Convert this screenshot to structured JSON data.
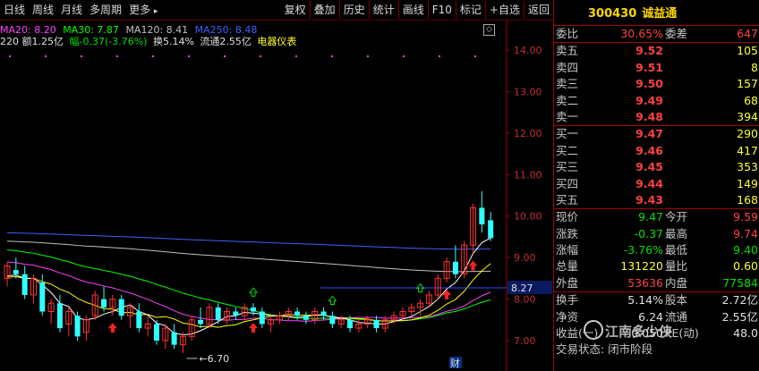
{
  "toolbar": {
    "left": [
      "日线",
      "周线",
      "月线",
      "多周期",
      "更多"
    ],
    "more_arrow": "▸",
    "right": [
      "复权",
      "叠加",
      "历史",
      "统计",
      "画线",
      "F10",
      "标记",
      "+自选",
      "返回"
    ]
  },
  "ma_line": {
    "ma20": "MA20: 8.20",
    "ma30": "MA30: 7.87",
    "ma120": "MA120: 8.41",
    "ma250": "MA250: 8.48"
  },
  "info_line": {
    "vol": "220 额1.25亿",
    "chg": "幅-0.37(-3.76%)",
    "turn": "换5.14%",
    "float": "流通2.55亿",
    "sector": "电器仪表"
  },
  "close_glyph": "◇",
  "chart_data": {
    "type": "candlestick",
    "y_ticks": [
      "14.00",
      "13.00",
      "12.00",
      "11.00",
      "10.00",
      "9.00",
      "8.00",
      "7.00"
    ],
    "ylim": [
      6.7,
      14.6
    ],
    "price_tag": "8.27",
    "low_label": "6.70",
    "event_marker": "财",
    "candles": [
      {
        "o": 8.5,
        "h": 8.9,
        "l": 8.3,
        "c": 8.8
      },
      {
        "o": 8.7,
        "h": 9.0,
        "l": 8.5,
        "c": 8.6
      },
      {
        "o": 8.6,
        "h": 8.8,
        "l": 8.0,
        "c": 8.1
      },
      {
        "o": 8.1,
        "h": 8.6,
        "l": 7.9,
        "c": 8.5
      },
      {
        "o": 8.4,
        "h": 8.6,
        "l": 7.6,
        "c": 7.7
      },
      {
        "o": 7.7,
        "h": 8.0,
        "l": 7.4,
        "c": 7.9
      },
      {
        "o": 7.9,
        "h": 8.1,
        "l": 7.2,
        "c": 7.3
      },
      {
        "o": 7.4,
        "h": 7.8,
        "l": 7.1,
        "c": 7.7
      },
      {
        "o": 7.6,
        "h": 7.7,
        "l": 7.0,
        "c": 7.1
      },
      {
        "o": 7.2,
        "h": 7.6,
        "l": 7.0,
        "c": 7.5
      },
      {
        "o": 7.6,
        "h": 8.2,
        "l": 7.5,
        "c": 8.1
      },
      {
        "o": 8.0,
        "h": 8.3,
        "l": 7.7,
        "c": 7.8
      },
      {
        "o": 7.8,
        "h": 8.1,
        "l": 7.6,
        "c": 8.0
      },
      {
        "o": 8.0,
        "h": 8.1,
        "l": 7.5,
        "c": 7.6
      },
      {
        "o": 7.6,
        "h": 7.9,
        "l": 7.3,
        "c": 7.8
      },
      {
        "o": 7.7,
        "h": 7.9,
        "l": 7.2,
        "c": 7.3
      },
      {
        "o": 7.3,
        "h": 7.6,
        "l": 7.1,
        "c": 7.4
      },
      {
        "o": 7.4,
        "h": 7.5,
        "l": 6.9,
        "c": 7.0
      },
      {
        "o": 7.0,
        "h": 7.4,
        "l": 6.8,
        "c": 7.3
      },
      {
        "o": 7.2,
        "h": 7.4,
        "l": 6.8,
        "c": 6.9
      },
      {
        "o": 6.9,
        "h": 7.2,
        "l": 6.7,
        "c": 7.1
      },
      {
        "o": 7.1,
        "h": 7.6,
        "l": 7.0,
        "c": 7.5
      },
      {
        "o": 7.5,
        "h": 7.8,
        "l": 7.3,
        "c": 7.4
      },
      {
        "o": 7.4,
        "h": 7.9,
        "l": 7.3,
        "c": 7.8
      },
      {
        "o": 7.8,
        "h": 7.9,
        "l": 7.4,
        "c": 7.5
      },
      {
        "o": 7.5,
        "h": 7.8,
        "l": 7.4,
        "c": 7.7
      },
      {
        "o": 7.7,
        "h": 7.8,
        "l": 7.5,
        "c": 7.6
      },
      {
        "o": 7.6,
        "h": 7.9,
        "l": 7.5,
        "c": 7.8
      },
      {
        "o": 7.8,
        "h": 7.9,
        "l": 7.6,
        "c": 7.7
      },
      {
        "o": 7.7,
        "h": 7.8,
        "l": 7.3,
        "c": 7.4
      },
      {
        "o": 7.4,
        "h": 7.6,
        "l": 7.2,
        "c": 7.5
      },
      {
        "o": 7.5,
        "h": 7.7,
        "l": 7.4,
        "c": 7.6
      },
      {
        "o": 7.6,
        "h": 7.8,
        "l": 7.5,
        "c": 7.7
      },
      {
        "o": 7.7,
        "h": 7.8,
        "l": 7.5,
        "c": 7.6
      },
      {
        "o": 7.6,
        "h": 7.7,
        "l": 7.4,
        "c": 7.5
      },
      {
        "o": 7.5,
        "h": 7.8,
        "l": 7.4,
        "c": 7.7
      },
      {
        "o": 7.7,
        "h": 7.8,
        "l": 7.5,
        "c": 7.6
      },
      {
        "o": 7.6,
        "h": 7.7,
        "l": 7.3,
        "c": 7.4
      },
      {
        "o": 7.4,
        "h": 7.6,
        "l": 7.3,
        "c": 7.5
      },
      {
        "o": 7.5,
        "h": 7.6,
        "l": 7.2,
        "c": 7.3
      },
      {
        "o": 7.3,
        "h": 7.5,
        "l": 7.2,
        "c": 7.4
      },
      {
        "o": 7.4,
        "h": 7.6,
        "l": 7.3,
        "c": 7.5
      },
      {
        "o": 7.5,
        "h": 7.6,
        "l": 7.2,
        "c": 7.3
      },
      {
        "o": 7.3,
        "h": 7.6,
        "l": 7.2,
        "c": 7.5
      },
      {
        "o": 7.5,
        "h": 7.7,
        "l": 7.4,
        "c": 7.6
      },
      {
        "o": 7.6,
        "h": 7.8,
        "l": 7.5,
        "c": 7.7
      },
      {
        "o": 7.7,
        "h": 7.9,
        "l": 7.6,
        "c": 7.8
      },
      {
        "o": 7.8,
        "h": 8.0,
        "l": 7.6,
        "c": 7.9
      },
      {
        "o": 7.9,
        "h": 8.2,
        "l": 7.8,
        "c": 8.1
      },
      {
        "o": 8.1,
        "h": 8.6,
        "l": 8.0,
        "c": 8.5
      },
      {
        "o": 8.5,
        "h": 9.0,
        "l": 8.4,
        "c": 8.9
      },
      {
        "o": 8.9,
        "h": 9.3,
        "l": 8.5,
        "c": 8.6
      },
      {
        "o": 8.6,
        "h": 9.4,
        "l": 8.5,
        "c": 9.3
      },
      {
        "o": 9.3,
        "h": 10.3,
        "l": 9.1,
        "c": 10.2
      },
      {
        "o": 10.2,
        "h": 10.6,
        "l": 9.6,
        "c": 9.8
      },
      {
        "o": 9.9,
        "h": 10.1,
        "l": 9.4,
        "c": 9.47
      }
    ]
  },
  "panel": {
    "code": "300430",
    "name": "诚益通",
    "webi_label": "委比",
    "webi_value": "30.65%",
    "weicha_label": "委差",
    "weicha_value": "647",
    "asks": [
      {
        "label": "卖五",
        "price": "9.52",
        "vol": "105"
      },
      {
        "label": "卖四",
        "price": "9.51",
        "vol": "8"
      },
      {
        "label": "卖三",
        "price": "9.50",
        "vol": "157"
      },
      {
        "label": "卖二",
        "price": "9.49",
        "vol": "68"
      },
      {
        "label": "卖一",
        "price": "9.48",
        "vol": "394"
      }
    ],
    "bids": [
      {
        "label": "买一",
        "price": "9.47",
        "vol": "290"
      },
      {
        "label": "买二",
        "price": "9.46",
        "vol": "417"
      },
      {
        "label": "买三",
        "price": "9.45",
        "vol": "353"
      },
      {
        "label": "买四",
        "price": "9.44",
        "vol": "149"
      },
      {
        "label": "买五",
        "price": "9.43",
        "vol": "168"
      }
    ],
    "stats": [
      {
        "l1": "现价",
        "v1": "9.47",
        "c1": "grn",
        "l2": "今开",
        "v2": "9.59",
        "c2": "red"
      },
      {
        "l1": "涨跌",
        "v1": "-0.37",
        "c1": "grn",
        "l2": "最高",
        "v2": "9.74",
        "c2": "red"
      },
      {
        "l1": "涨幅",
        "v1": "-3.76%",
        "c1": "grn",
        "l2": "最低",
        "v2": "9.40",
        "c2": "grn"
      },
      {
        "l1": "总量",
        "v1": "131220",
        "c1": "yel",
        "l2": "量比",
        "v2": "0.60",
        "c2": "yel"
      },
      {
        "l1": "外盘",
        "v1": "53636",
        "c1": "red",
        "l2": "内盘",
        "v2": "77584",
        "c2": "grn"
      }
    ],
    "extra": [
      {
        "l1": "换手",
        "v1": "5.14%",
        "c1": "wht",
        "l2": "股本",
        "v2": "2.72亿",
        "c2": "wht"
      },
      {
        "l1": "净资",
        "v1": "6.24",
        "c1": "wht",
        "l2": "流通",
        "v2": "2.55亿",
        "c2": "wht"
      },
      {
        "l1": "收益(一)",
        "v1": "0.050",
        "c1": "wht",
        "l2": "PE(动)",
        "v2": "48.0",
        "c2": "wht"
      }
    ],
    "trade_status": "交易状态: 闭市阶段",
    "watermark": "江南多少侠"
  },
  "colors": {
    "ma5": "#ffffff",
    "ma10": "#ffff00",
    "ma20": "#ff40ff",
    "ma30": "#00ff00",
    "ma120": "#c0c0c0",
    "ma250": "#4060ff",
    "up": "#ff3030",
    "down": "#30ffff"
  }
}
